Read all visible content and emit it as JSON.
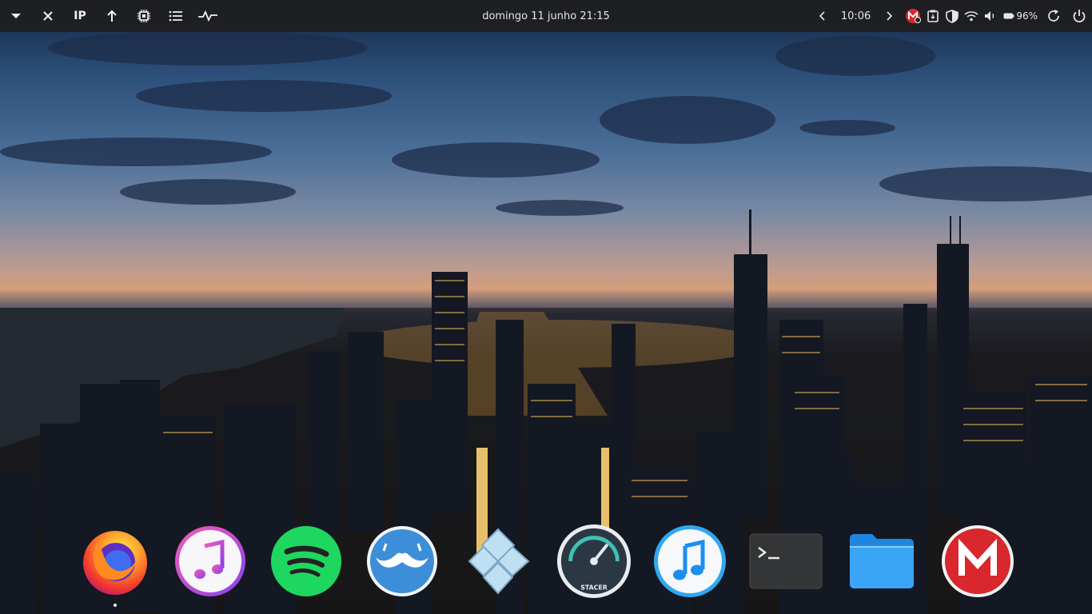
{
  "topbar": {
    "left_buttons": [
      {
        "name": "menu-dropdown",
        "glyph": "▼"
      },
      {
        "name": "close",
        "glyph": "✕"
      },
      {
        "name": "ip",
        "label": "IP"
      },
      {
        "name": "upload",
        "glyph": "↑"
      },
      {
        "name": "cpu",
        "glyph": "cpu"
      },
      {
        "name": "task-list",
        "glyph": "list"
      },
      {
        "name": "activity",
        "glyph": "pulse"
      }
    ],
    "datetime": "domingo 11 junho  21:15",
    "timer": "10:06",
    "battery_percent": "96%"
  },
  "dock": {
    "apps": [
      {
        "name": "firefox",
        "icon": "firefox-icon"
      },
      {
        "name": "itunes",
        "icon": "music-note-icon"
      },
      {
        "name": "spotify",
        "icon": "spotify-icon"
      },
      {
        "name": "mustache-app",
        "icon": "mustache-icon"
      },
      {
        "name": "ppsspp",
        "icon": "gamepad-icon"
      },
      {
        "name": "stacer",
        "icon": "stacer-icon",
        "label": "STACER"
      },
      {
        "name": "music-player",
        "icon": "music-note-blue-icon"
      },
      {
        "name": "terminal",
        "icon": "terminal-icon"
      },
      {
        "name": "files",
        "icon": "folder-icon"
      },
      {
        "name": "mega",
        "icon": "mega-icon"
      }
    ]
  },
  "colors": {
    "topbar_bg": "#1e1f22",
    "mega_red": "#d9272e",
    "spotify_green": "#1ed760",
    "folder_blue": "#2f9cf5"
  }
}
